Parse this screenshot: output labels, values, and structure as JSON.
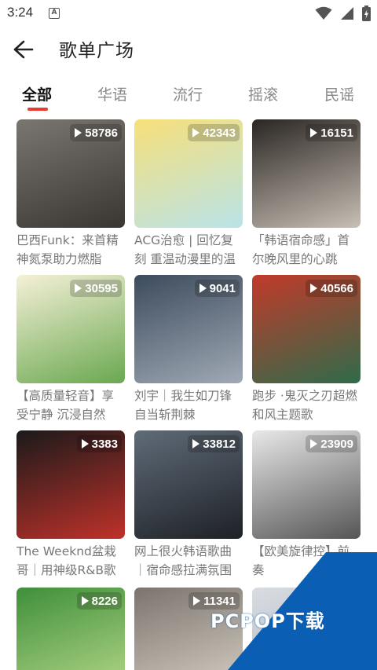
{
  "status_bar": {
    "time": "3:24",
    "notification_letter": "A"
  },
  "header": {
    "title": "歌单广场"
  },
  "tabs": [
    {
      "label": "全部",
      "active": true
    },
    {
      "label": "华语",
      "active": false
    },
    {
      "label": "流行",
      "active": false
    },
    {
      "label": "摇滚",
      "active": false
    },
    {
      "label": "民谣",
      "active": false
    }
  ],
  "playlists": [
    {
      "count": "58786",
      "title": "巴西Funk：来首精神氮泵助力燃脂",
      "colors": [
        "#7a7670",
        "#3a3530"
      ]
    },
    {
      "count": "42343",
      "title": "ACG治愈 | 回忆复刻 重温动漫里的温",
      "colors": [
        "#f7e07a",
        "#b9e3e8"
      ]
    },
    {
      "count": "16151",
      "title": "「韩语宿命感」首尔晚风里的心跳",
      "colors": [
        "#2a2622",
        "#c8bfb5"
      ]
    },
    {
      "count": "30595",
      "title": "【高质量轻音】享受宁静 沉浸自然",
      "colors": [
        "#f5f0d8",
        "#6aa84f"
      ]
    },
    {
      "count": "9041",
      "title": "刘宇｜我生如刀锋自当斩荆棘",
      "colors": [
        "#3c4b5c",
        "#a0a9b5"
      ]
    },
    {
      "count": "40566",
      "title": "跑步 ·鬼灭之刃超燃和风主题歌",
      "colors": [
        "#c23a2a",
        "#2f6b4a"
      ]
    },
    {
      "count": "3383",
      "title": "The Weeknd盆栽哥｜用神级R&B歌声",
      "colors": [
        "#1a1a1a",
        "#c0312a"
      ]
    },
    {
      "count": "33812",
      "title": "网上很火韩语歌曲｜宿命感拉满氛围",
      "colors": [
        "#5f6b78",
        "#1e2126"
      ]
    },
    {
      "count": "23909",
      "title": "【欧美旋律控】前奏",
      "colors": [
        "#e8e8e8",
        "#555555"
      ]
    },
    {
      "count": "8226",
      "title": "",
      "colors": [
        "#3f8f3a",
        "#b7d98a"
      ]
    },
    {
      "count": "11341",
      "title": "",
      "colors": [
        "#7b746d",
        "#d9d2c8"
      ]
    },
    {
      "count": "",
      "title": "",
      "colors": [
        "#d9dde2",
        "#a5aeb8"
      ]
    }
  ],
  "watermark": {
    "text": "PCPOP下载",
    "accent": "#0a5fb4"
  },
  "colors": {
    "accent": "#e83a2f"
  }
}
